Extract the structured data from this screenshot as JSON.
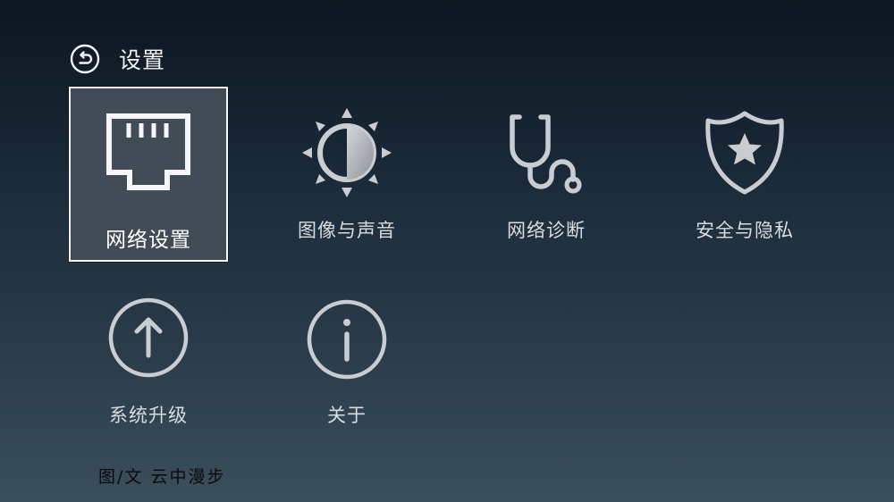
{
  "header": {
    "back_icon": "back-arrow-icon",
    "title": "设置"
  },
  "menu": {
    "items": [
      {
        "label": "网络设置",
        "icon": "ethernet-port-icon",
        "focused": true
      },
      {
        "label": "图像与声音",
        "icon": "brightness-icon",
        "focused": false
      },
      {
        "label": "网络诊断",
        "icon": "stethoscope-icon",
        "focused": false
      },
      {
        "label": "安全与隐私",
        "icon": "shield-star-icon",
        "focused": false
      },
      {
        "label": "系统升级",
        "icon": "upgrade-arrow-icon",
        "focused": false
      },
      {
        "label": "关于",
        "icon": "info-icon",
        "focused": false
      }
    ]
  },
  "watermark": "图/文  云中漫步",
  "colors": {
    "background_top": "#0d1520",
    "background_bottom": "#3a4e5c",
    "focus_tile": "#414c57",
    "focus_border": "#f4f6f8",
    "icon": "#c9cdd1"
  }
}
